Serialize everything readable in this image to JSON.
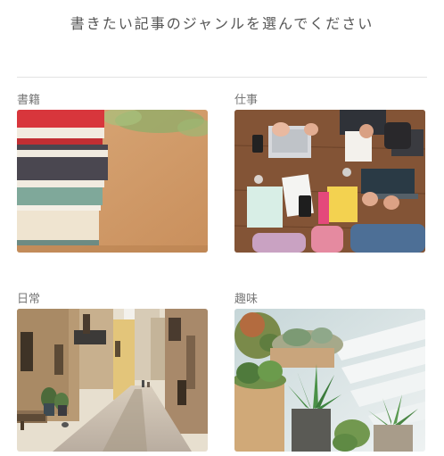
{
  "header": {
    "title": "書きたい記事のジャンルを選んでください"
  },
  "genres": [
    {
      "label": "書籍",
      "image": "books-photo"
    },
    {
      "label": "仕事",
      "image": "work-desk-photo"
    },
    {
      "label": "日常",
      "image": "street-photo"
    },
    {
      "label": "趣味",
      "image": "plants-photo"
    }
  ]
}
